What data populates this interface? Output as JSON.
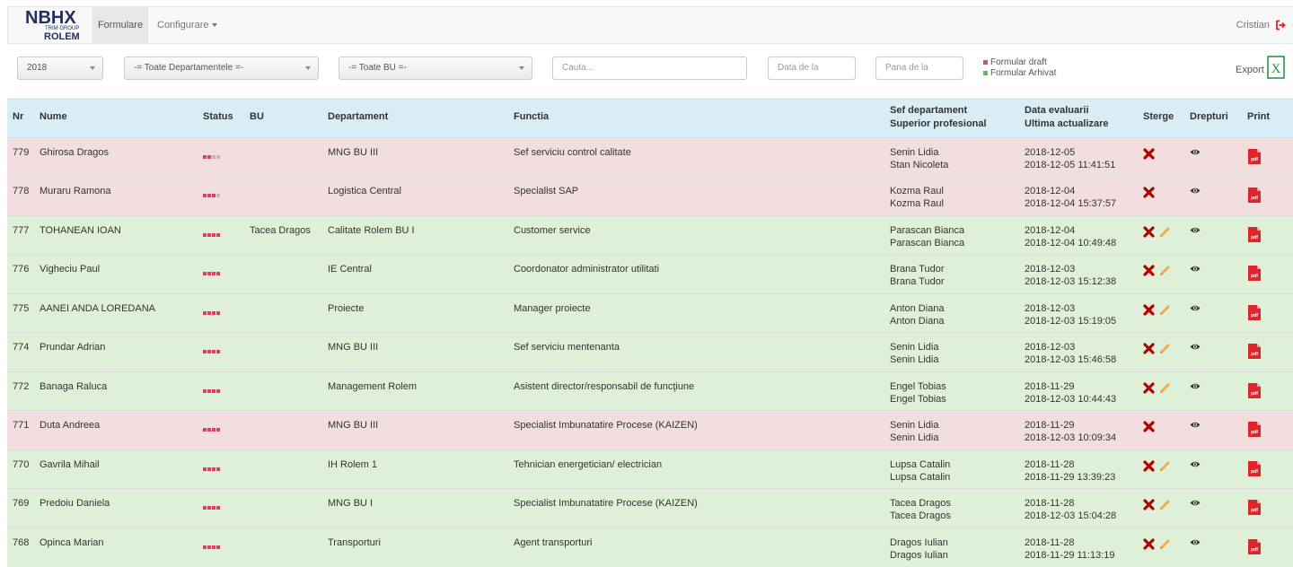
{
  "brand": {
    "logo_main": "NBHX",
    "logo_sub": "TRIM GROUP",
    "logo_bottom": "ROLEM"
  },
  "nav": {
    "active": "Formulare",
    "config": "Configurare",
    "user": "Cristian"
  },
  "filters": {
    "year": "2018",
    "department": "-= Toate Departamentele =-",
    "bu": "-= Toate BU =-",
    "search_placeholder": "Cauta...",
    "date_from_placeholder": "Data de la",
    "date_to_placeholder": "Pana de la"
  },
  "legend": {
    "draft": "Formular draft",
    "archived": "Formular Arhivat",
    "draft_color": "#d9534f",
    "archived_color": "#5cb85c"
  },
  "export_label": "Export",
  "columns": {
    "nr": "Nr",
    "name": "Nume",
    "status": "Status",
    "bu": "BU",
    "department": "Departament",
    "function": "Functia",
    "sef_line1": "Sef departament",
    "sef_line2": "Superior profesional",
    "date_line1": "Data evaluarii",
    "date_line2": "Ultima actualizare",
    "delete": "Sterge",
    "rights": "Drepturi",
    "print": "Print"
  },
  "colors": {
    "status_red": "#e03c64",
    "status_gray": "#bbbbbb",
    "delete_red": "#b30000",
    "pencil": "#f0ad4e",
    "pdf_red": "#e0262d"
  },
  "rows": [
    {
      "nr": "779",
      "name": "Ghirosa Dragos",
      "status_filled": 2,
      "bu": "",
      "department": "MNG BU III",
      "function": "Sef serviciu control calitate",
      "sef": "Senin Lidia",
      "superior": "Stan Nicoleta",
      "date": "2018-12-05",
      "updated": "2018-12-05 11:41:51",
      "state": "red",
      "editable": false
    },
    {
      "nr": "778",
      "name": "Muraru Ramona",
      "status_filled": 3,
      "bu": "",
      "department": "Logistica Central",
      "function": "Specialist SAP",
      "sef": "Kozma Raul",
      "superior": "Kozma Raul",
      "date": "2018-12-04",
      "updated": "2018-12-04 15:37:57",
      "state": "red",
      "editable": false
    },
    {
      "nr": "777",
      "name": "TOHANEAN IOAN",
      "status_filled": 4,
      "bu": "Tacea Dragos",
      "department": "Calitate Rolem BU I",
      "function": "Customer service",
      "sef": "Parascan Bianca",
      "superior": "Parascan Bianca",
      "date": "2018-12-04",
      "updated": "2018-12-04 10:49:48",
      "state": "green",
      "editable": true
    },
    {
      "nr": "776",
      "name": "Vigheciu Paul",
      "status_filled": 4,
      "bu": "",
      "department": "IE Central",
      "function": "Coordonator administrator utilitati",
      "sef": "Brana Tudor",
      "superior": "Brana Tudor",
      "date": "2018-12-03",
      "updated": "2018-12-03 15:12:38",
      "state": "green",
      "editable": true
    },
    {
      "nr": "775",
      "name": "AANEI ANDA LOREDANA",
      "status_filled": 4,
      "bu": "",
      "department": "Proiecte",
      "function": "Manager proiecte",
      "sef": "Anton Diana",
      "superior": "Anton Diana",
      "date": "2018-12-03",
      "updated": "2018-12-03 15:19:05",
      "state": "green",
      "editable": true
    },
    {
      "nr": "774",
      "name": "Prundar Adrian",
      "status_filled": 4,
      "bu": "",
      "department": "MNG BU III",
      "function": "Sef serviciu mentenanta",
      "sef": "Senin Lidia",
      "superior": "Senin Lidia",
      "date": "2018-12-03",
      "updated": "2018-12-03 15:46:58",
      "state": "green",
      "editable": true
    },
    {
      "nr": "772",
      "name": "Banaga Raluca",
      "status_filled": 4,
      "bu": "",
      "department": "Management Rolem",
      "function": "Asistent director/responsabil de funcţiune",
      "sef": "Engel Tobias",
      "superior": "Engel Tobias",
      "date": "2018-11-29",
      "updated": "2018-12-03 10:44:43",
      "state": "green",
      "editable": true
    },
    {
      "nr": "771",
      "name": "Duta Andreea",
      "status_filled": 4,
      "bu": "",
      "department": "MNG BU III",
      "function": "Specialist Imbunatatire Procese (KAIZEN)",
      "sef": "Senin Lidia",
      "superior": "Senin Lidia",
      "date": "2018-11-29",
      "updated": "2018-12-03 10:09:34",
      "state": "red",
      "editable": false
    },
    {
      "nr": "770",
      "name": "Gavrila Mihail",
      "status_filled": 4,
      "bu": "",
      "department": "IH Rolem 1",
      "function": "Tehnician energetician/ electrician",
      "sef": "Lupsa Catalin",
      "superior": "Lupsa Catalin",
      "date": "2018-11-28",
      "updated": "2018-11-29 13:39:23",
      "state": "green",
      "editable": true
    },
    {
      "nr": "769",
      "name": "Predoiu Daniela",
      "status_filled": 4,
      "bu": "",
      "department": "MNG BU I",
      "function": "Specialist Imbunatatire Procese (KAIZEN)",
      "sef": "Tacea Dragos",
      "superior": "Tacea Dragos",
      "date": "2018-11-28",
      "updated": "2018-12-03 15:04:28",
      "state": "green",
      "editable": true
    },
    {
      "nr": "768",
      "name": "Opinca Marian",
      "status_filled": 4,
      "bu": "",
      "department": "Transporturi",
      "function": "Agent transporturi",
      "sef": "Dragos Iulian",
      "superior": "Dragos Iulian",
      "date": "2018-11-28",
      "updated": "2018-11-29 11:13:19",
      "state": "green",
      "editable": true
    }
  ]
}
